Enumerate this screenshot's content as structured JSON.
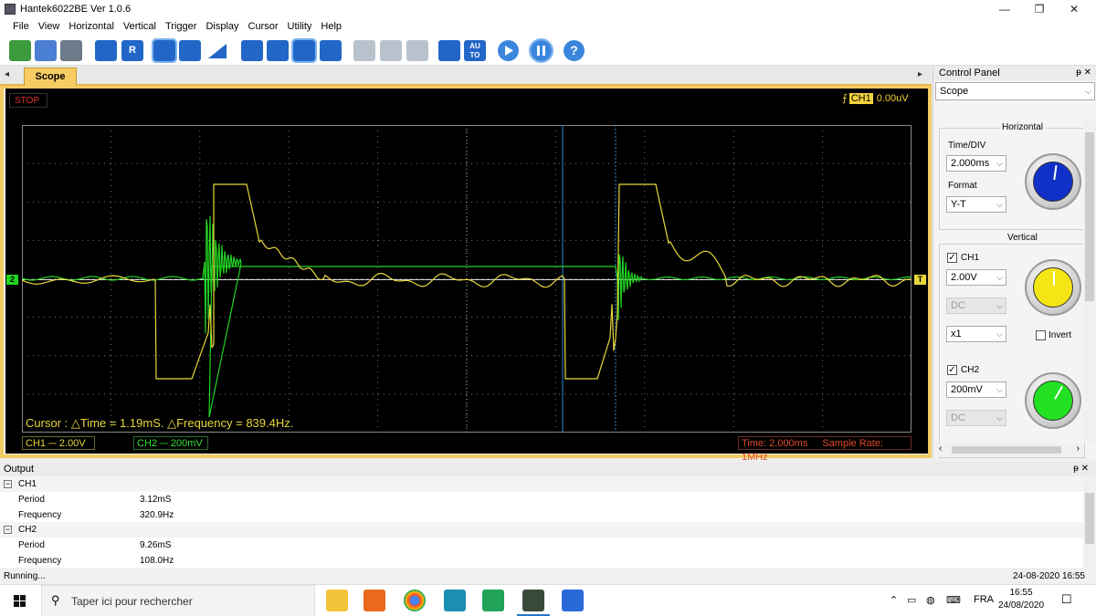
{
  "window": {
    "title": "Hantek6022BE Ver 1.0.6",
    "minimize": "—",
    "maximize": "❐",
    "close": "✕"
  },
  "menu": [
    "File",
    "View",
    "Horizontal",
    "Vertical",
    "Trigger",
    "Display",
    "Cursor",
    "Utility",
    "Help"
  ],
  "toolbar": {
    "r_label": "R",
    "auto_label": "AU TO",
    "help_label": "?"
  },
  "scope": {
    "tab_label": "Scope",
    "status": "STOP",
    "trigger_channel": "CH1",
    "trigger_level": "0.00uV",
    "cursor_info": "Cursor : △Time = 1.19mS. △Frequency = 839.4Hz.",
    "ch1_scale": "CH1 ⎓  2.00V",
    "ch2_scale": "CH2 ⎓  200mV",
    "time_label": "Time: 2.000ms",
    "sample_rate": "Sample Rate: 1MHz",
    "left_marker": "2",
    "right_marker": "T",
    "colors": {
      "ch1": "#e8d83a",
      "ch2": "#22d422",
      "cursor": "#2a8ad8",
      "grid": "#888888"
    }
  },
  "control_panel": {
    "title": "Control Panel",
    "pin": "ᵽ ✕",
    "mode": "Scope",
    "horizontal": {
      "group": "Horizontal",
      "timediv_label": "Time/DIV",
      "timediv_value": "2.000ms",
      "format_label": "Format",
      "format_value": "Y-T",
      "knob_color": "#1030c8"
    },
    "vertical": {
      "group": "Vertical",
      "ch1_label": "CH1",
      "ch1_checked": true,
      "ch1_volts": "2.00V",
      "ch1_coupling": "DC",
      "ch1_probe": "x1",
      "invert_label": "Invert",
      "ch1_knob_color": "#f4e614",
      "ch2_label": "CH2",
      "ch2_checked": true,
      "ch2_volts": "200mV",
      "ch2_coupling": "DC",
      "ch2_knob_color": "#22e022"
    }
  },
  "output": {
    "title": "Output",
    "pin": "ᵽ ✕",
    "groups": [
      {
        "name": "CH1",
        "rows": [
          {
            "key": "Period",
            "value": "3.12mS"
          },
          {
            "key": "Frequency",
            "value": "320.9Hz"
          }
        ]
      },
      {
        "name": "CH2",
        "rows": [
          {
            "key": "Period",
            "value": "9.26mS"
          },
          {
            "key": "Frequency",
            "value": "108.0Hz"
          }
        ]
      }
    ]
  },
  "app_status": {
    "text": "Running...",
    "datetime": "24-08-2020 16:55"
  },
  "taskbar": {
    "search_placeholder": "Taper ici pour rechercher",
    "language": "FRA",
    "time": "16:55",
    "date": "24/08/2020",
    "tray_arrow": "⌃"
  }
}
